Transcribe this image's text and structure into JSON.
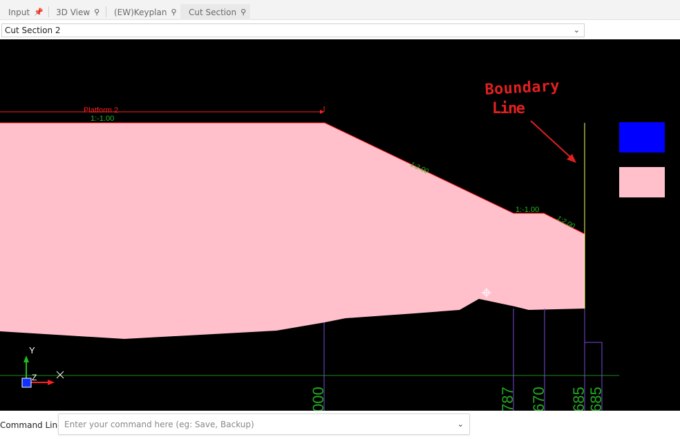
{
  "tabs": [
    {
      "label": "Input",
      "pinned": true
    },
    {
      "label": "3D View",
      "pinned": false
    },
    {
      "label": "(EW)Keyplan",
      "pinned": false
    },
    {
      "label": "Cut Section",
      "pinned": false,
      "active": true
    }
  ],
  "view_selector": {
    "value": "Cut Section 2"
  },
  "drawing": {
    "platform_label": "Platform 2",
    "slopes": [
      "1:-1.00",
      "1:2.00",
      "1:-1.00",
      "1:2.00"
    ],
    "annotation": {
      "line1": "Boundary",
      "line2": "Line"
    },
    "stations": [
      "000",
      "787",
      "670",
      "685",
      "685"
    ],
    "axes": {
      "x": "X",
      "y": "Y",
      "z": "Z"
    },
    "legend_colors": [
      "#0000ff",
      "#ffc0cb"
    ],
    "fill_color": "#ffc0cb",
    "boundary_color": "#ffff66"
  },
  "command_line": {
    "label": "Command Line:",
    "placeholder": "Enter your command here (eg: Save, Backup)"
  }
}
